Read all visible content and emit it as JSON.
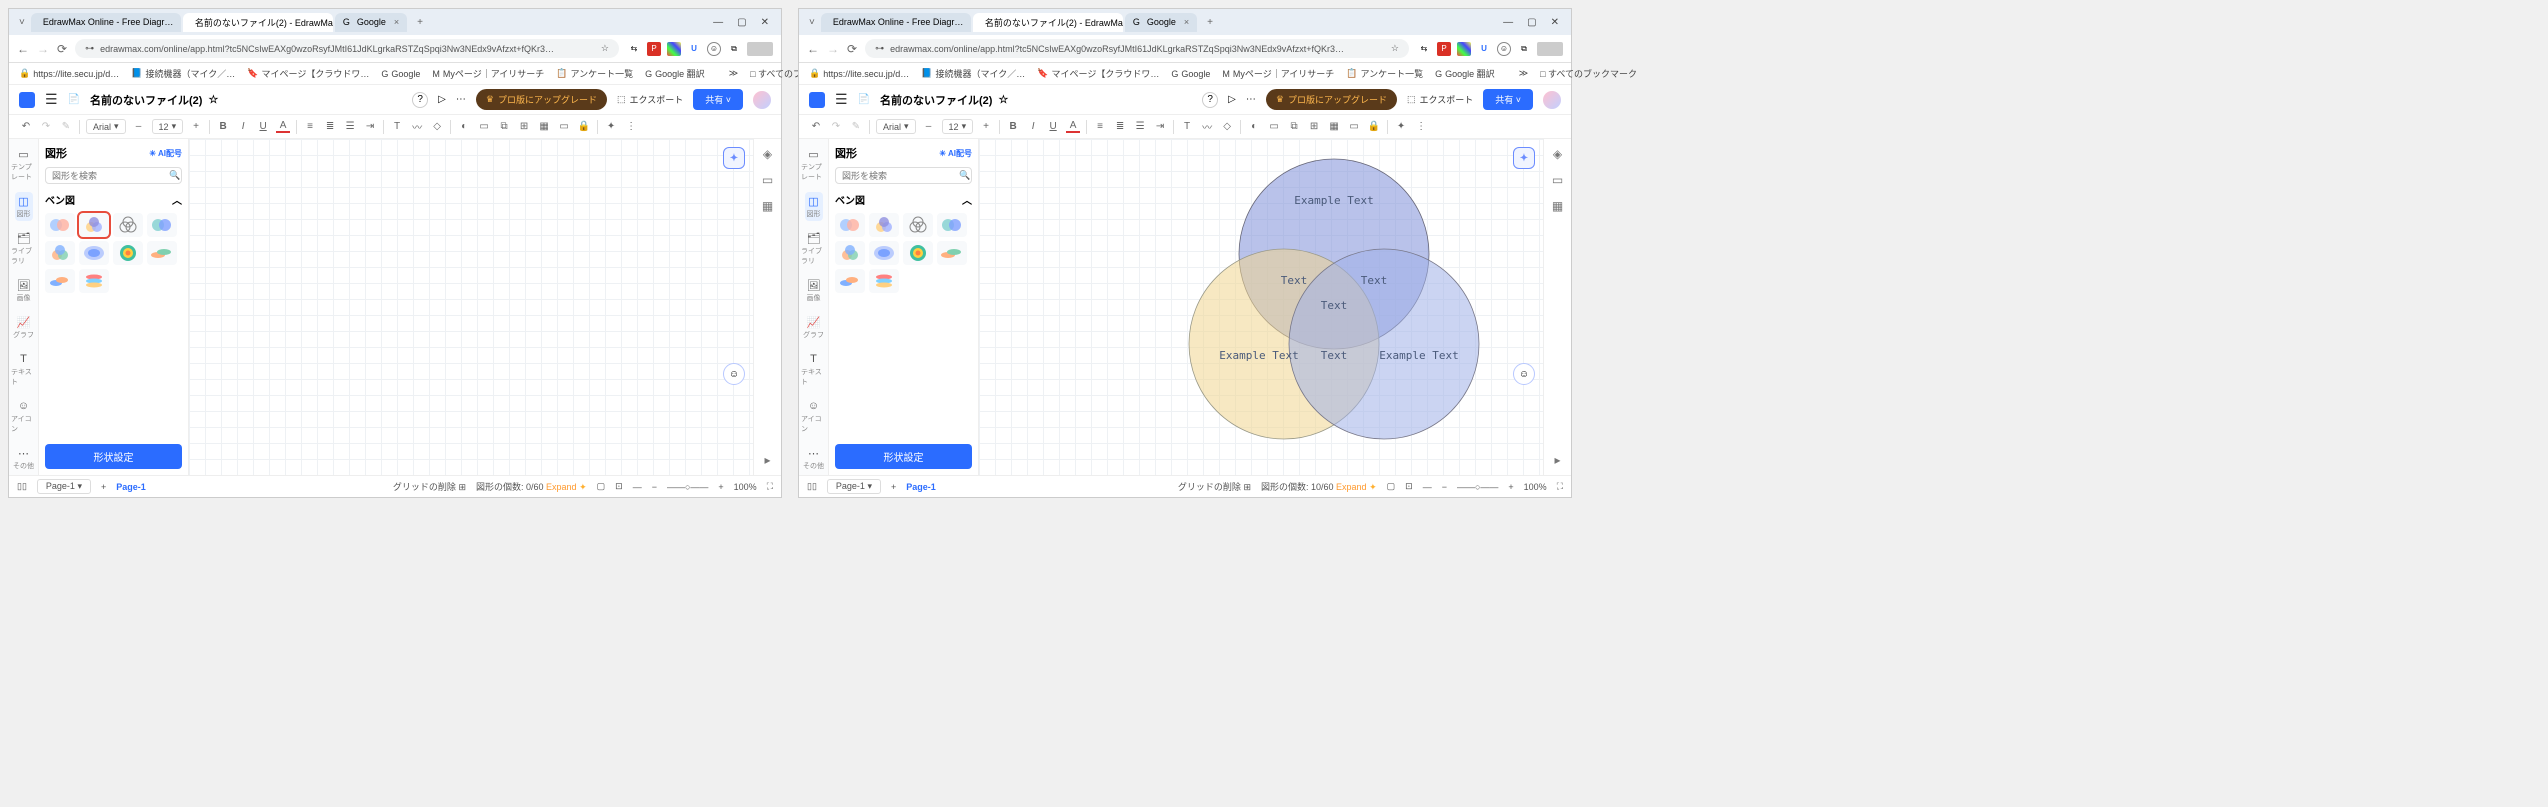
{
  "tabs": [
    {
      "title": "EdrawMax Online - Free Diagr…",
      "close": "×"
    },
    {
      "title": "名前のないファイル(2) - EdrawMax",
      "close": "×",
      "active": true
    },
    {
      "title": "Google",
      "close": "×"
    }
  ],
  "newtab": "+",
  "win": {
    "min": "—",
    "max": "▢",
    "close": "✕",
    "down": "˅"
  },
  "nav": {
    "back": "←",
    "fwd": "→",
    "reload": "⟳"
  },
  "url": "edrawmax.com/online/app.html?tc5NCsIwEAXg0wzoRsyfJMtI61JdKLgrkaRSTZqSpqi3Nw3NEdx9vAfzxt+fQKr3…",
  "url_star": "☆",
  "ext": {
    "trans": "⇆",
    "pdf": "P",
    "pal": "◧",
    "u": "U",
    "face": "☺",
    "copy": "⧉",
    "avatar": ""
  },
  "bookmarks": [
    {
      "icon": "🔒",
      "label": "https://lite.secu.jp/d…"
    },
    {
      "icon": "📘",
      "label": "接続機器（マイク／…"
    },
    {
      "icon": "🔖",
      "label": "マイページ【クラウドワ…"
    },
    {
      "icon": "G",
      "label": "Google"
    },
    {
      "icon": "M",
      "label": "Myページ｜アイリサーチ"
    },
    {
      "icon": "📋",
      "label": "アンケート一覧"
    },
    {
      "icon": "G",
      "label": "Google 翻訳"
    }
  ],
  "allbm": {
    "icon": "≫",
    "label": "□ すべてのブックマーク"
  },
  "app": {
    "docname": "名前のないファイル(2)",
    "star": "☆",
    "help": "?",
    "play": "▷",
    "more": "⋯",
    "upgrade": "プロ版にアップグレード",
    "crown": "♛",
    "export_icon": "⬚",
    "export": "エクスポート",
    "share": "共有",
    "share_chev": "˅"
  },
  "fmt": {
    "undo": "↶",
    "redo": "↷",
    "brush": "✎",
    "font": "Arial",
    "font_chev": "▾",
    "size": "12",
    "minus": "–",
    "plus": "+",
    "bold": "B",
    "italic": "I",
    "under": "U",
    "color": "A",
    "align": "≡",
    "align2": "≣",
    "list": "☰",
    "indent": "⇥",
    "text": "T",
    "curve": "〰",
    "eraser": "◇",
    "fill": "◐",
    "line": "▭",
    "link": "⧉",
    "group": "⊞",
    "table": "▦",
    "lock": "🔒",
    "ai": "✦",
    "menu": "⋮"
  },
  "rail": [
    {
      "icon": "▭",
      "label": "テンプレート"
    },
    {
      "icon": "◫",
      "label": "図形",
      "on": true
    },
    {
      "icon": "🗂",
      "label": "ライブラリ"
    },
    {
      "icon": "🖼",
      "label": "画像"
    },
    {
      "icon": "📈",
      "label": "グラフ"
    },
    {
      "icon": "T",
      "label": "テキスト"
    },
    {
      "icon": "☺",
      "label": "アイコン"
    },
    {
      "icon": "⋯",
      "label": "その他"
    }
  ],
  "panel": {
    "title": "図形",
    "ai": "AI配号",
    "ai_icon": "✳",
    "search": "図形を検索",
    "search_icon": "🔍",
    "cat": "ベン図",
    "chev": "︿",
    "btn": "形状設定"
  },
  "rrail": [
    "◈",
    "▭",
    "▦"
  ],
  "fab": "✦",
  "bubble": "☺",
  "status": {
    "page_icon": "▯▯",
    "pagetab": "Page-1",
    "pagetab_chev": "▾",
    "pageadd": "+",
    "pageactive": "Page-1",
    "grid": "グリッドの削除",
    "grid_icon": "⊞",
    "count_label_left": "図形の個数: 0/60",
    "count_label_right": "図形の個数: 10/60",
    "expand": "Expand",
    "expand_icon": "✦",
    "map": "▢",
    "snap": "⊡",
    "ruler": "—",
    "slider": "——○——",
    "zoomout": "−",
    "zoomin": "+",
    "zoom": "100%",
    "full": "⛶"
  },
  "venn": {
    "top": "Example Text",
    "l2": "Text",
    "r2": "Text",
    "c": "Text",
    "c2": "Text",
    "bl": "Example Text",
    "br": "Example Text"
  }
}
